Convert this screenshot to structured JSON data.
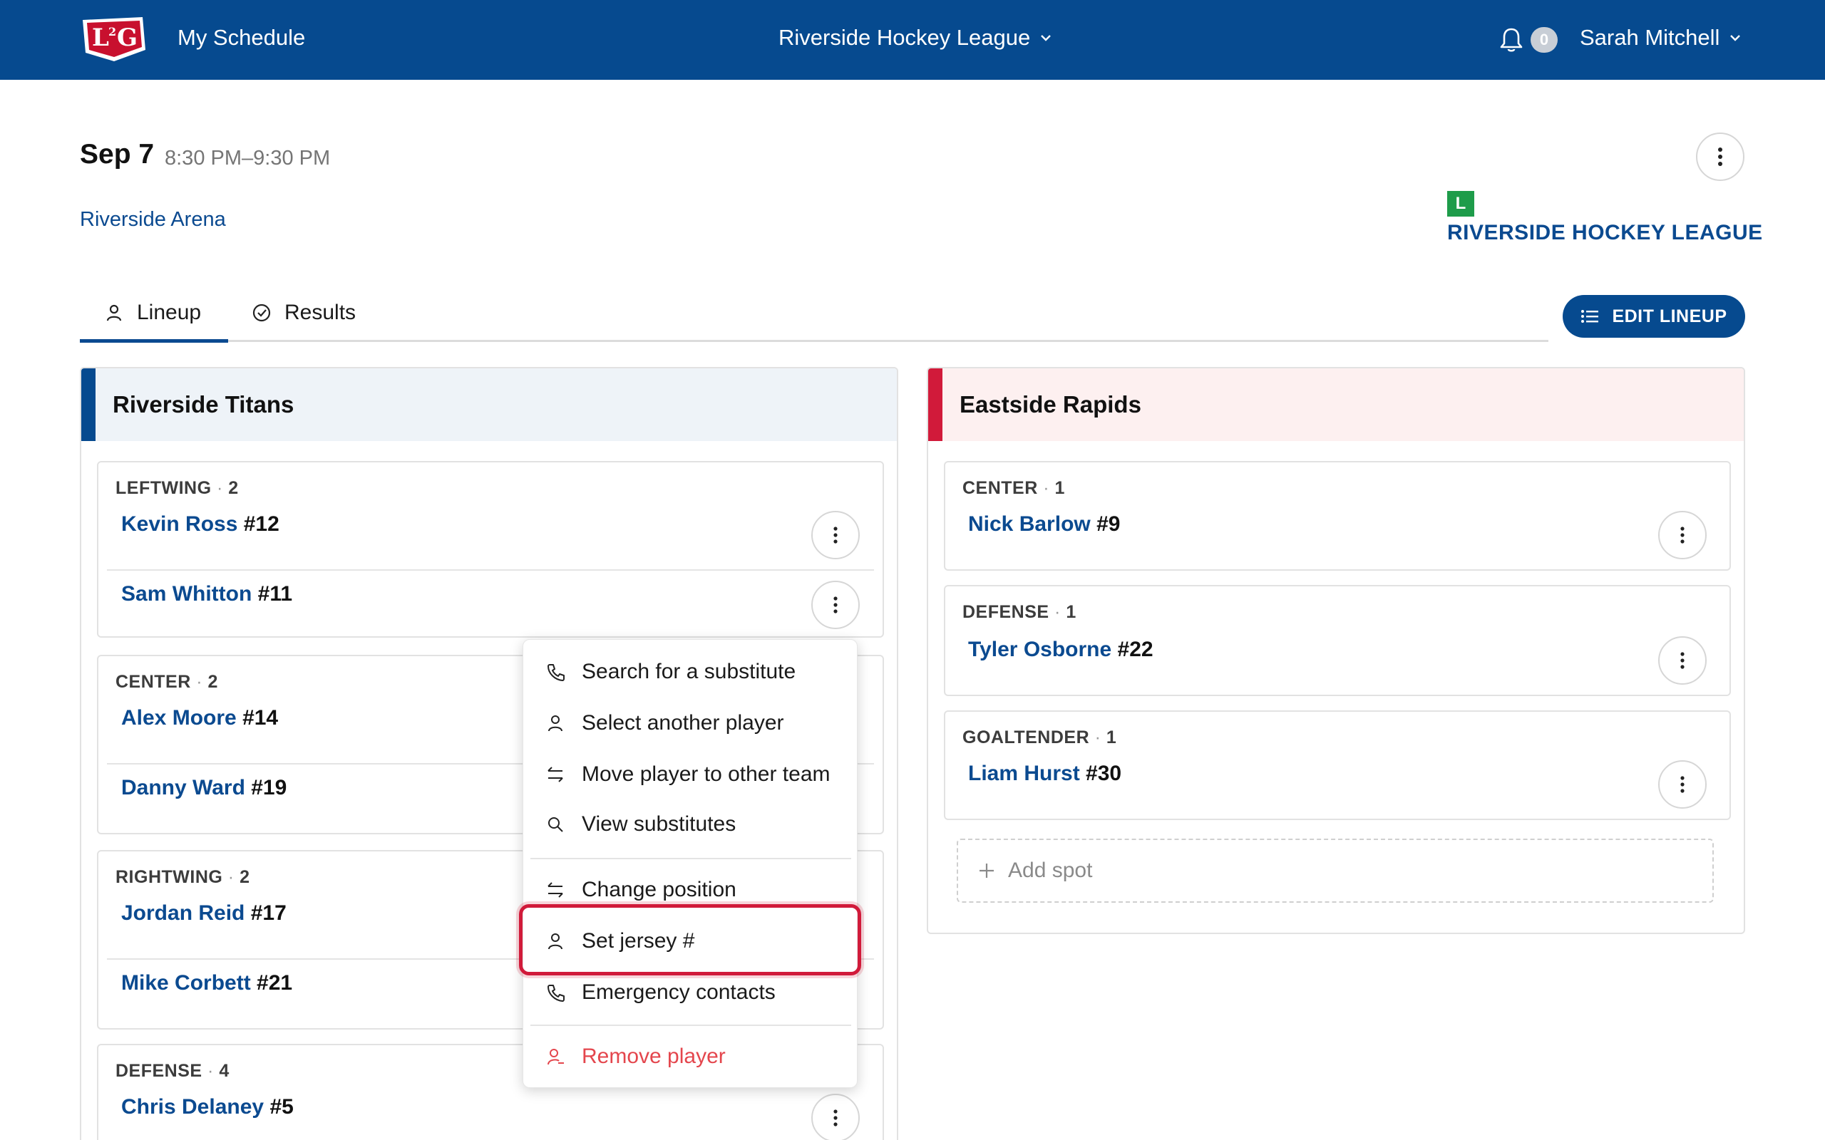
{
  "topbar": {
    "logo_text": "L2G",
    "nav_title": "My Schedule",
    "league_select": "Riverside Hockey League",
    "notification_count": "0",
    "user_name": "Sarah Mitchell"
  },
  "event": {
    "date": "Sep 7",
    "time": "8:30 PM–9:30 PM",
    "venue": "Riverside Arena",
    "league_badge": "L",
    "league_name": "RIVERSIDE HOCKEY LEAGUE"
  },
  "tabs": [
    {
      "label": "Lineup",
      "icon": "person-icon",
      "active": true
    },
    {
      "label": "Results",
      "icon": "check-circle-icon",
      "active": false
    }
  ],
  "edit_lineup_label": "EDIT LINEUP",
  "teams": {
    "home": {
      "name": "Riverside Titans",
      "accent": "#064a8f",
      "header_bg": "#eef3f8",
      "groups": [
        {
          "position": "LEFTWING",
          "count": "2",
          "players": [
            {
              "name": "Kevin Ross",
              "number": "#12"
            },
            {
              "name": "Sam Whitton",
              "number": "#11"
            }
          ]
        },
        {
          "position": "CENTER",
          "count": "2",
          "players": [
            {
              "name": "Alex Moore",
              "number": "#14"
            },
            {
              "name": "Danny Ward",
              "number": "#19"
            }
          ]
        },
        {
          "position": "RIGHTWING",
          "count": "2",
          "players": [
            {
              "name": "Jordan Reid",
              "number": "#17"
            },
            {
              "name": "Mike Corbett",
              "number": "#21"
            }
          ]
        },
        {
          "position": "DEFENSE",
          "count": "4",
          "players": [
            {
              "name": "Chris Delaney",
              "number": "#5"
            }
          ]
        }
      ]
    },
    "away": {
      "name": "Eastside Rapids",
      "accent": "#d11a3a",
      "header_bg": "#fdf0f0",
      "groups": [
        {
          "position": "CENTER",
          "count": "1",
          "players": [
            {
              "name": "Nick Barlow",
              "number": "#9"
            }
          ]
        },
        {
          "position": "DEFENSE",
          "count": "1",
          "players": [
            {
              "name": "Tyler Osborne",
              "number": "#22"
            }
          ]
        },
        {
          "position": "GOALTENDER",
          "count": "1",
          "players": [
            {
              "name": "Liam Hurst",
              "number": "#30"
            }
          ]
        }
      ],
      "add_spot_label": "Add spot"
    }
  },
  "player_menu": {
    "items": [
      {
        "label": "Search for a substitute",
        "icon": "phone-icon"
      },
      {
        "label": "Select another player",
        "icon": "person-icon"
      },
      {
        "label": "Move player to other team",
        "icon": "swap-icon"
      },
      {
        "label": "View substitutes",
        "icon": "search-icon"
      },
      {
        "label": "Change position",
        "icon": "swap-icon"
      },
      {
        "label": "Set jersey #",
        "icon": "person-icon",
        "highlighted": true
      },
      {
        "label": "Emergency contacts",
        "icon": "phone-icon"
      },
      {
        "label": "Remove player",
        "icon": "remove-person-icon",
        "danger": true
      }
    ]
  }
}
